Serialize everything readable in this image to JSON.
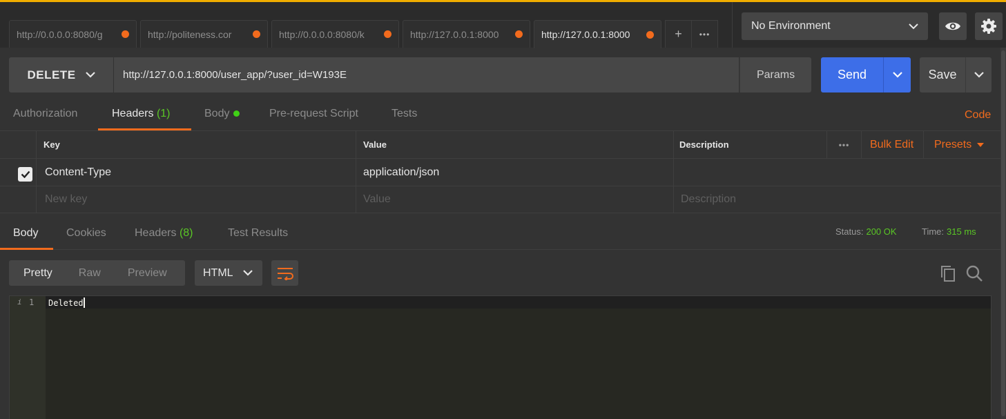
{
  "request_tabs": [
    {
      "label": "http://0.0.0.0:8080/g",
      "unsaved": true
    },
    {
      "label": "http://politeness.cor",
      "unsaved": true
    },
    {
      "label": "http://0.0.0.0:8080/k",
      "unsaved": true
    },
    {
      "label": "http://127.0.0.1:8000",
      "unsaved": true
    },
    {
      "label": "http://127.0.0.1:8000",
      "unsaved": true
    }
  ],
  "tab_actions": {
    "add": "+",
    "more": "•••"
  },
  "environment": {
    "selected": "No Environment"
  },
  "request": {
    "method": "DELETE",
    "url": "http://127.0.0.1:8000/user_app/?user_id=W193E",
    "params_label": "Params",
    "send_label": "Send",
    "save_label": "Save"
  },
  "request_tabs_nav": {
    "authorization": "Authorization",
    "headers": "Headers",
    "headers_count": "(1)",
    "body": "Body",
    "prerequest": "Pre-request Script",
    "tests": "Tests",
    "code": "Code"
  },
  "headers_table": {
    "columns": {
      "key": "Key",
      "value": "Value",
      "description": "Description"
    },
    "more": "•••",
    "bulk_edit": "Bulk Edit",
    "presets": "Presets",
    "rows": [
      {
        "checked": true,
        "key": "Content-Type",
        "value": "application/json",
        "description": ""
      }
    ],
    "placeholders": {
      "key": "New key",
      "value": "Value",
      "description": "Description"
    }
  },
  "response": {
    "tabs": {
      "body": "Body",
      "cookies": "Cookies",
      "headers": "Headers",
      "headers_count": "(8)",
      "test_results": "Test Results"
    },
    "status_label": "Status:",
    "status_value": "200 OK",
    "time_label": "Time:",
    "time_value": "315 ms",
    "view_modes": {
      "pretty": "Pretty",
      "raw": "Raw",
      "preview": "Preview"
    },
    "format": "HTML",
    "body_lines": [
      {
        "number": "1",
        "text": "Deleted"
      }
    ]
  },
  "colors": {
    "accent": "#f26b1d",
    "send": "#3d6ee8",
    "success": "#5ac725",
    "top_border": "#f0ad00"
  }
}
